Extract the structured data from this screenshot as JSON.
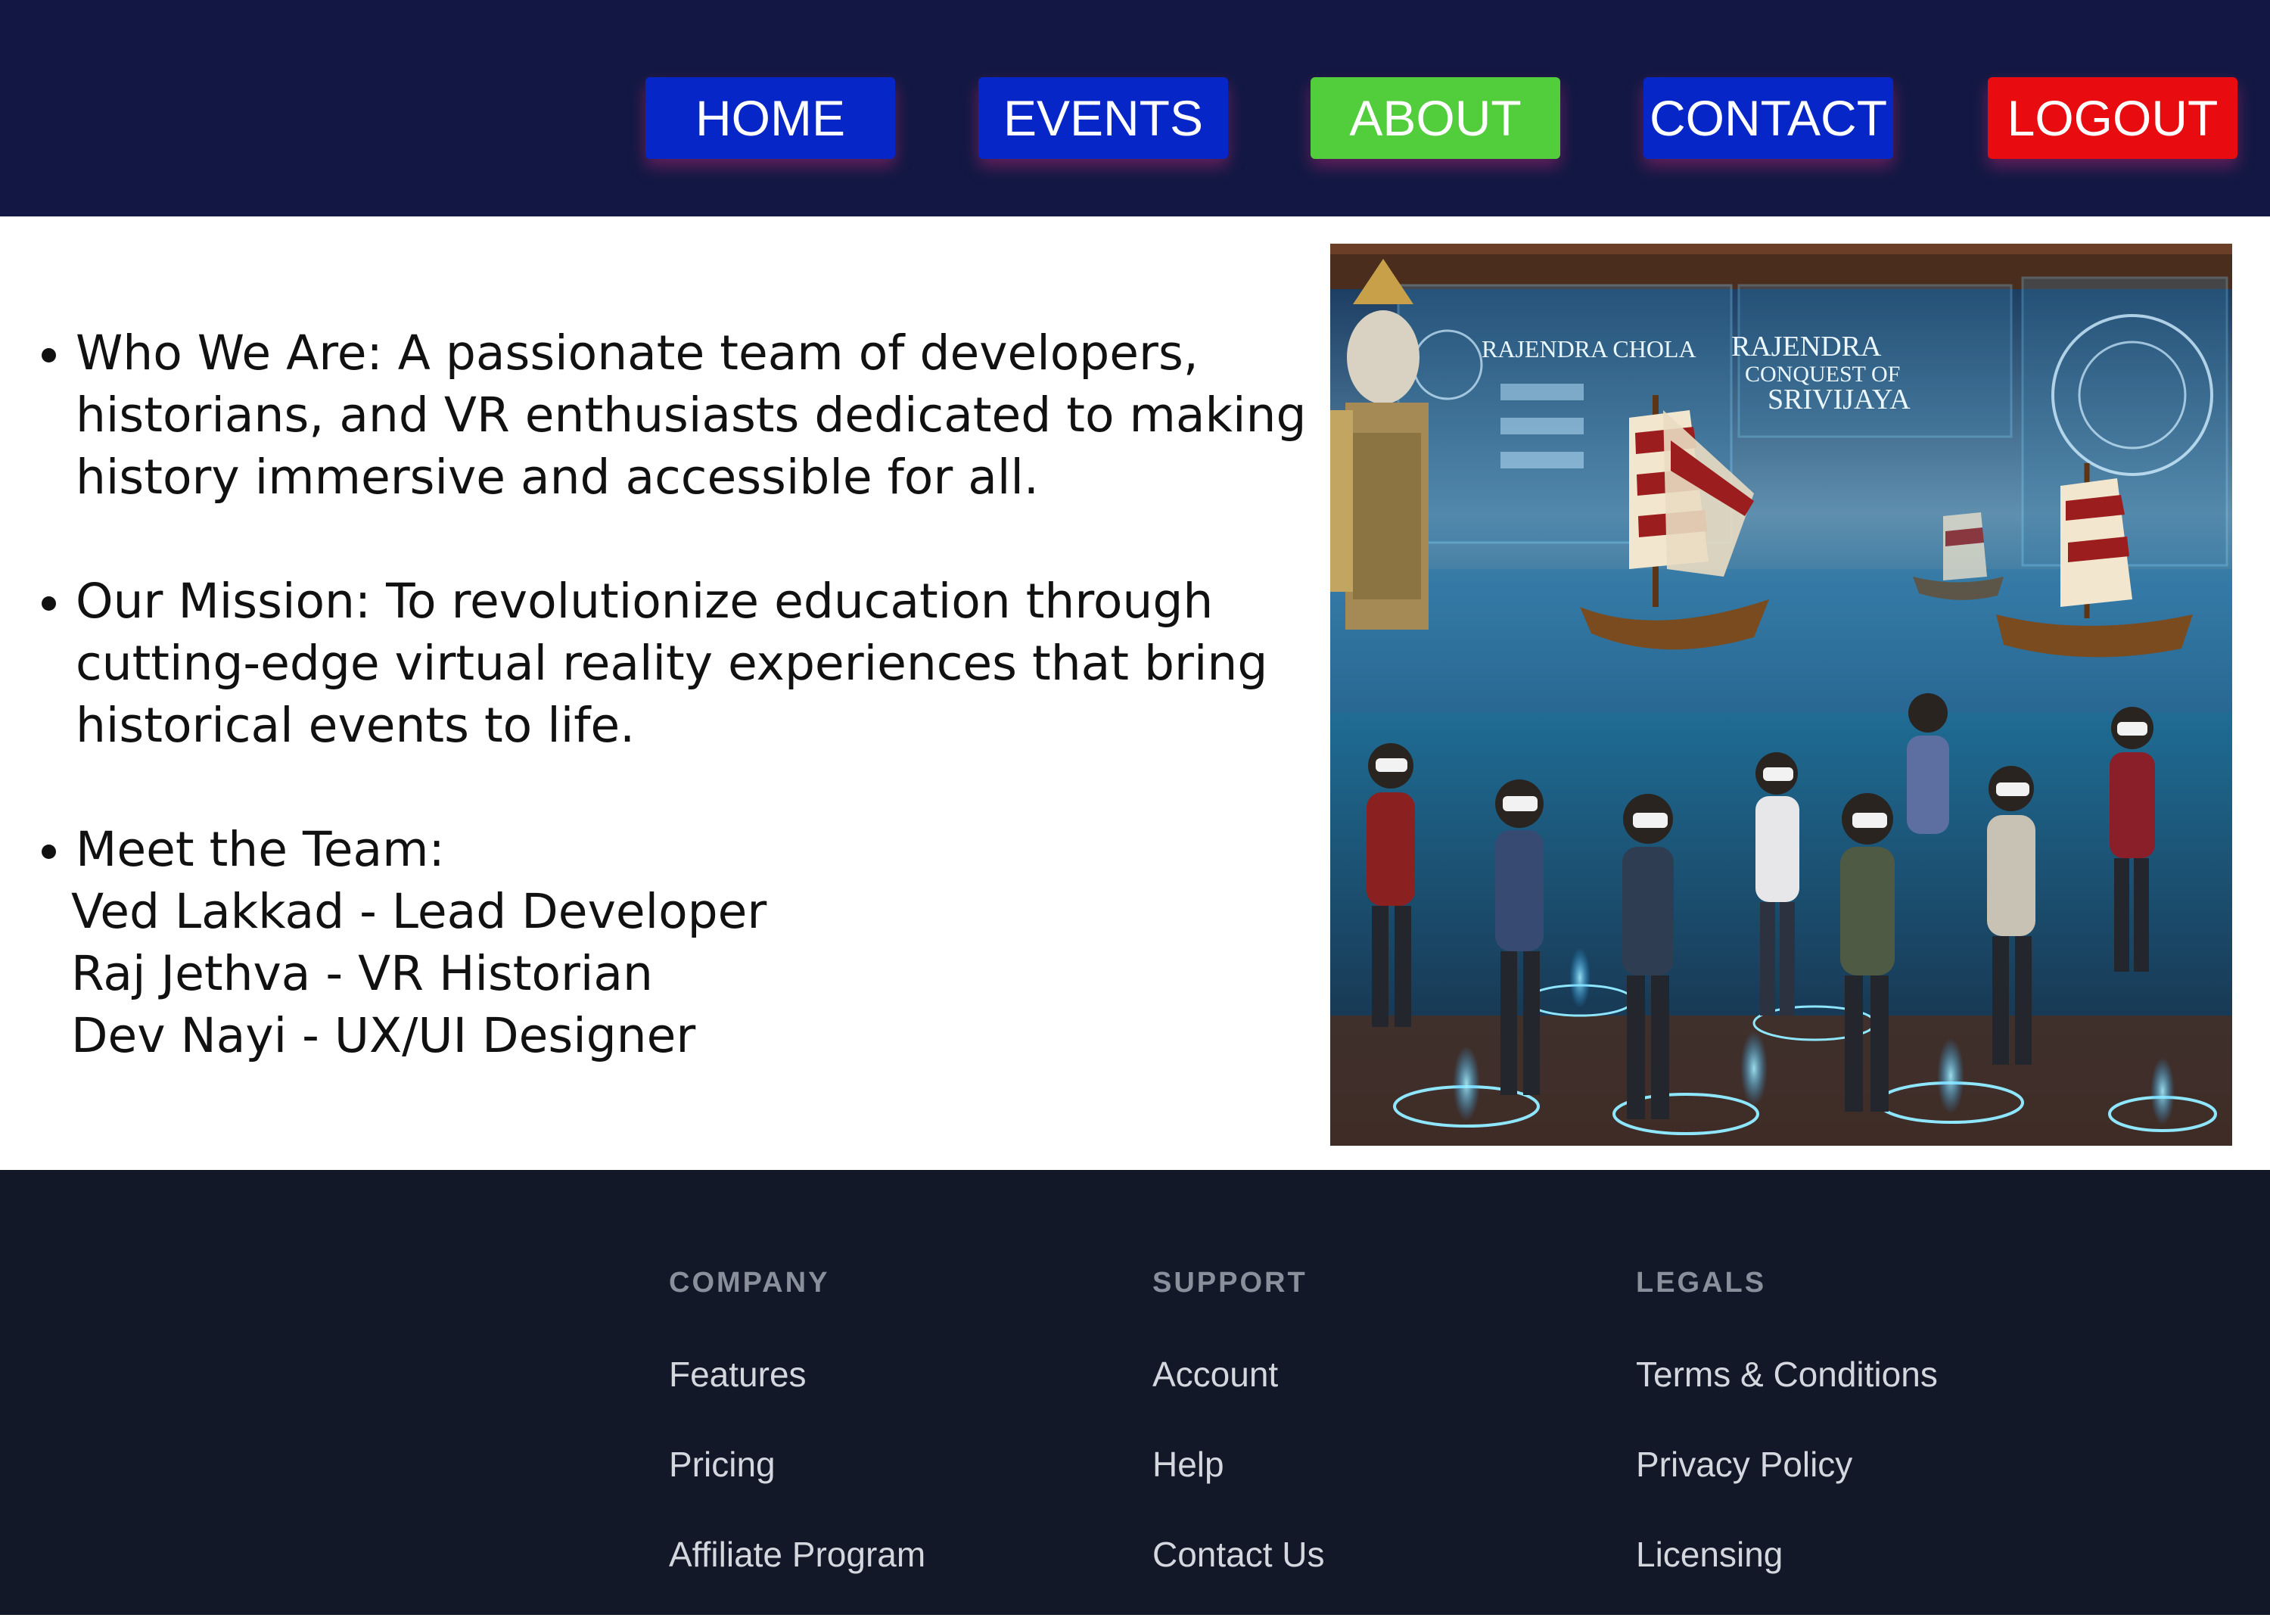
{
  "nav": {
    "items": [
      {
        "label": "HOME",
        "color": "#0726c8"
      },
      {
        "label": "EVENTS",
        "color": "#0726c8"
      },
      {
        "label": "ABOUT",
        "color": "#52cd3c"
      },
      {
        "label": "CONTACT",
        "color": "#0726c8"
      },
      {
        "label": "LOGOUT",
        "color": "#e80c10"
      }
    ]
  },
  "about": {
    "who": "Who We Are: A passionate team of developers, historians, and VR enthusiasts dedicated to making history immersive and accessible for all.",
    "mission": "Our Mission: To revolutionize education through cutting-edge virtual reality experiences that bring historical events to life.",
    "team_heading": "Meet the Team:",
    "team": [
      "Ved Lakkad - Lead Developer",
      "Raj Jethva - VR Historian",
      "Dev Nayi - UX/UI Designer"
    ]
  },
  "hero": {
    "caption_left": "RAJENDRA CHOLA",
    "caption_right_1": "RAJENDRA",
    "caption_right_2": "CONQUEST OF",
    "caption_right_3": "SRIVIJAYA"
  },
  "footer": {
    "columns": [
      {
        "heading": "COMPANY",
        "links": [
          "Features",
          "Pricing",
          "Affiliate Program"
        ]
      },
      {
        "heading": "SUPPORT",
        "links": [
          "Account",
          "Help",
          "Contact Us"
        ]
      },
      {
        "heading": "LEGALS",
        "links": [
          "Terms & Conditions",
          "Privacy Policy",
          "Licensing"
        ]
      }
    ]
  }
}
